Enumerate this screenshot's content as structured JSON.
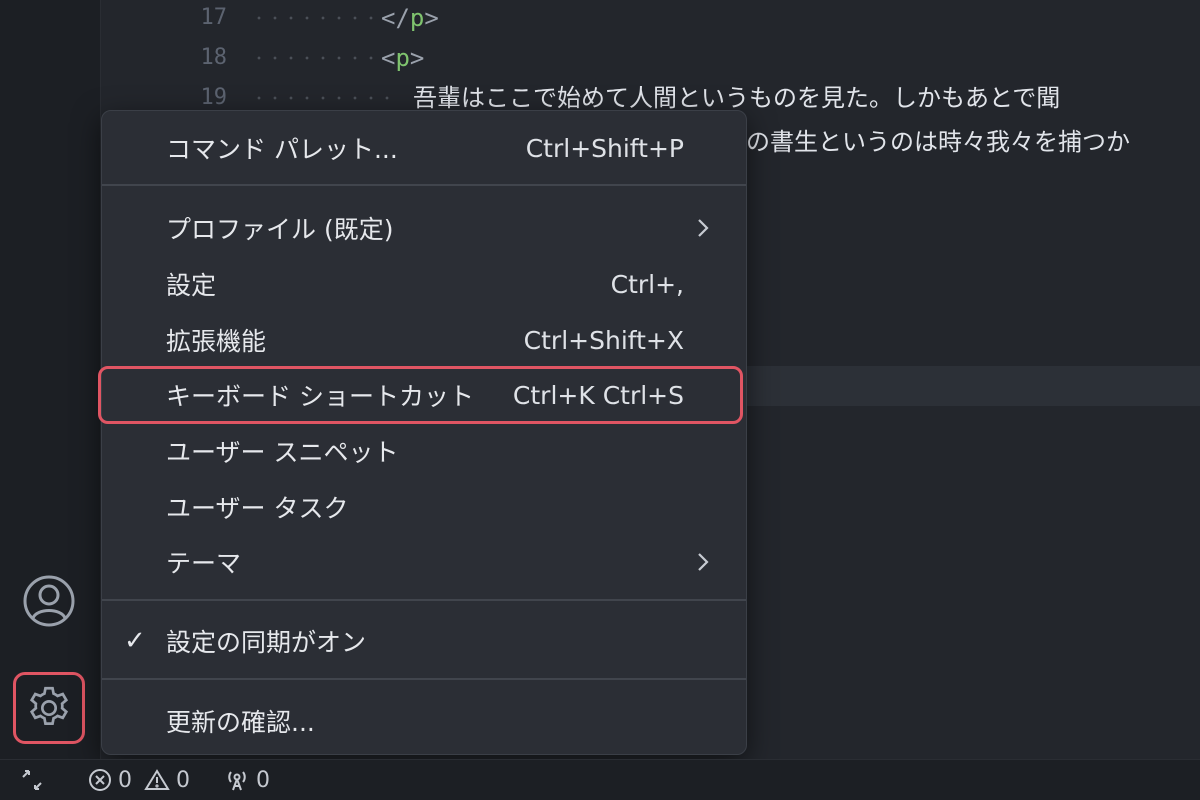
{
  "editor": {
    "lines": [
      {
        "number": "17",
        "code_open": "</",
        "tag": "p",
        "code_close": ">",
        "text": ""
      },
      {
        "number": "18",
        "code_open": "<",
        "tag": "p",
        "code_close": ">",
        "text": ""
      },
      {
        "number": "19",
        "code_open": "",
        "tag": "",
        "code_close": "",
        "text": "吾輩はここで始めて人間というものを見た。しかもあとで聞"
      },
      {
        "number": "",
        "code_open": "",
        "tag": "",
        "code_close": "",
        "text": "の書生というのは時々我々を捕つか"
      }
    ]
  },
  "menu": {
    "command_palette": {
      "label": "コマンド パレット...",
      "shortcut": "Ctrl+Shift+P"
    },
    "profile": {
      "label": "プロファイル (既定)"
    },
    "settings": {
      "label": "設定",
      "shortcut": "Ctrl+,"
    },
    "extensions": {
      "label": "拡張機能",
      "shortcut": "Ctrl+Shift+X"
    },
    "keyboard_shortcuts": {
      "label": "キーボード ショートカット",
      "shortcut": "Ctrl+K Ctrl+S"
    },
    "user_snippets": {
      "label": "ユーザー スニペット"
    },
    "user_tasks": {
      "label": "ユーザー タスク"
    },
    "theme": {
      "label": "テーマ"
    },
    "settings_sync": {
      "check": "✓",
      "label": "設定の同期がオン"
    },
    "check_updates": {
      "label": "更新の確認..."
    }
  },
  "status_bar": {
    "errors": "0",
    "warnings": "0",
    "ports": "0"
  },
  "colors": {
    "highlight": "#e05563",
    "tag_name": "#7fc36e"
  }
}
